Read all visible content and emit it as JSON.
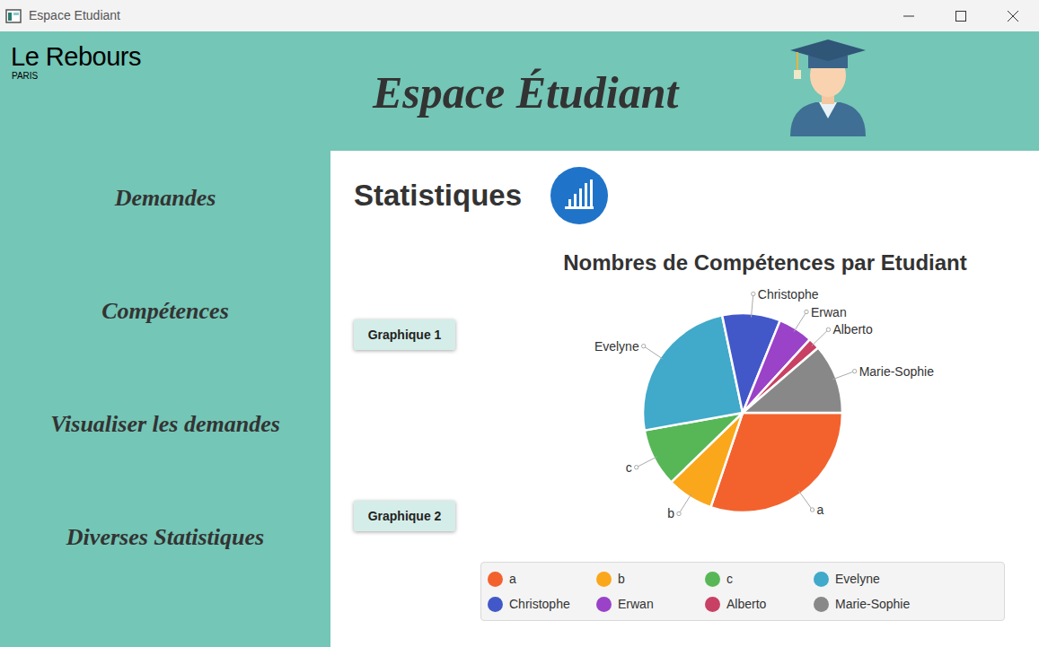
{
  "window": {
    "title": "Espace Etudiant"
  },
  "header": {
    "logo": "Le Rebours",
    "logo_sub": "PARIS",
    "title": "Espace Étudiant"
  },
  "sidebar": {
    "items": [
      "Demandes",
      "Compétences",
      "Visualiser les demandes",
      "Diverses Statistiques"
    ]
  },
  "page": {
    "title": "Statistiques"
  },
  "buttons": [
    "Graphique 1",
    "Graphique 2"
  ],
  "chart": {
    "title": "Nombres de Compétences par Etudiant",
    "slices": [
      {
        "label": "a",
        "value": 16,
        "color": "#f3622d"
      },
      {
        "label": "b",
        "value": 4,
        "color": "#fba71b"
      },
      {
        "label": "c",
        "value": 5,
        "color": "#57b757"
      },
      {
        "label": "Evelyne",
        "value": 13,
        "color": "#41a9c9"
      },
      {
        "label": "Christophe",
        "value": 5,
        "color": "#4258c9"
      },
      {
        "label": "Erwan",
        "value": 3,
        "color": "#9a42c8"
      },
      {
        "label": "Alberto",
        "value": 1,
        "color": "#c84164"
      },
      {
        "label": "Marie-Sophie",
        "value": 6,
        "color": "#888888"
      }
    ]
  }
}
